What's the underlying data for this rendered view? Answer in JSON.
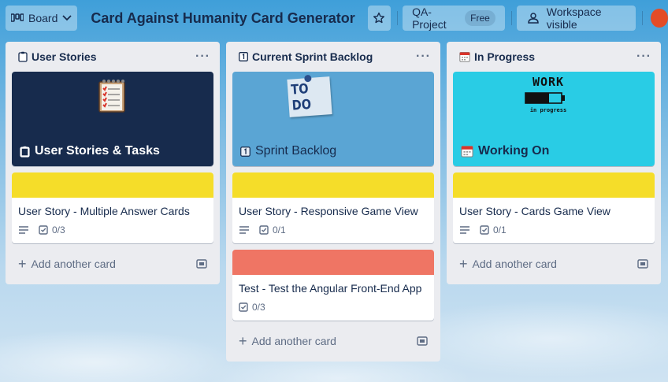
{
  "header": {
    "board_label": "Board",
    "title": "Card Against Humanity Card Generator",
    "project_label": "QA-Project",
    "project_badge": "Free",
    "visibility_label": "Workspace visible"
  },
  "lists": [
    {
      "title": "User Stories",
      "title_icon": "clipboard-icon",
      "cover_card": {
        "title": "User Stories & Tasks",
        "icon": "clipboard-icon",
        "bg": "#172b4d"
      },
      "cards": [
        {
          "cover_color": "#f5dd29",
          "title": "User Story - Multiple Answer Cards",
          "has_description": true,
          "checklist": "0/3"
        }
      ],
      "add_label": "Add another card"
    },
    {
      "title": "Current Sprint Backlog",
      "title_icon": "number-one-icon",
      "cover_card": {
        "title": "Sprint Backlog",
        "icon": "number-one-icon",
        "bg": "#5aa5d4",
        "sticker_text": "TO DO"
      },
      "cards": [
        {
          "cover_color": "#f5dd29",
          "title": "User Story - Responsive Game View",
          "has_description": true,
          "checklist": "0/1"
        },
        {
          "cover_color": "#ef7564",
          "title": "Test - Test the Angular Front-End App",
          "has_description": false,
          "checklist": "0/3"
        }
      ],
      "add_label": "Add another card"
    },
    {
      "title": "In Progress",
      "title_icon": "calendar-icon",
      "cover_card": {
        "title": "Working On",
        "icon": "calendar-icon",
        "bg": "#29cce5",
        "sketch_text": "WORK",
        "sketch_sub": "in progress"
      },
      "cards": [
        {
          "cover_color": "#f5dd29",
          "title": "User Story - Cards Game View",
          "has_description": true,
          "checklist": "0/1"
        }
      ],
      "add_label": "Add another card"
    }
  ]
}
